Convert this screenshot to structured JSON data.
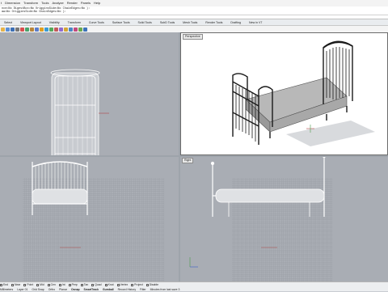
{
  "menubar": [
    "t",
    "Dimension",
    "Transform",
    "Tools",
    "Analyze",
    "Render",
    "Panels",
    "Help"
  ],
  "command_history": [
    "nce=No  DigestBox=No  OrigginsSide=No  ChainEdges=No  ):",
    "aw=No  OrigginsSide=No  ChainEdges=No  ):"
  ],
  "command_prompt": "",
  "tabs": [
    {
      "label": "Select",
      "active": false
    },
    {
      "label": "Viewport Layout",
      "active": false
    },
    {
      "label": "Visibility",
      "active": false
    },
    {
      "label": "Transform",
      "active": false
    },
    {
      "label": "Curve Tools",
      "active": false
    },
    {
      "label": "Surface Tools",
      "active": false
    },
    {
      "label": "Solid Tools",
      "active": false
    },
    {
      "label": "SubD Tools",
      "active": false
    },
    {
      "label": "Mesh Tools",
      "active": false
    },
    {
      "label": "Render Tools",
      "active": false
    },
    {
      "label": "Drafting",
      "active": false
    },
    {
      "label": "New in V7",
      "active": false
    }
  ],
  "toolbar_icons": [
    {
      "name": "new-icon",
      "color": "#e6b34a"
    },
    {
      "name": "open-icon",
      "color": "#5a8fd8"
    },
    {
      "name": "save-icon",
      "color": "#3c6fb5"
    },
    {
      "name": "print-icon",
      "color": "#777777"
    },
    {
      "name": "cut-icon",
      "color": "#d94f4f"
    },
    {
      "name": "copy-icon",
      "color": "#4aa36b"
    },
    {
      "name": "paste-icon",
      "color": "#b9853a"
    },
    {
      "name": "undo-icon",
      "color": "#5b7ec9"
    },
    {
      "name": "pan-icon",
      "color": "#e0a020"
    },
    {
      "name": "rotate-icon",
      "color": "#3a9bd5"
    },
    {
      "name": "zoom-icon",
      "color": "#56a85a"
    },
    {
      "name": "zoom-extents-icon",
      "color": "#c25b5b"
    },
    {
      "name": "zoom-window-icon",
      "color": "#8f6ad1"
    },
    {
      "name": "layer-icon",
      "color": "#d3a536"
    },
    {
      "name": "properties-icon",
      "color": "#4a86c5"
    },
    {
      "name": "render-icon",
      "color": "#c24a7e"
    },
    {
      "name": "options-icon",
      "color": "#6aa84f"
    },
    {
      "name": "help-icon",
      "color": "#3b73b9"
    }
  ],
  "viewports": {
    "top": {
      "label": ""
    },
    "perspective": {
      "label": "Perspective"
    },
    "front": {
      "label": ""
    },
    "right": {
      "label": "Right"
    }
  },
  "osnaps": [
    {
      "label": "End",
      "checked": false
    },
    {
      "label": "Near",
      "checked": false
    },
    {
      "label": "Point",
      "checked": false
    },
    {
      "label": "Mid",
      "checked": false
    },
    {
      "label": "Cen",
      "checked": false
    },
    {
      "label": "Int",
      "checked": false
    },
    {
      "label": "Perp",
      "checked": false
    },
    {
      "label": "Tan",
      "checked": false
    },
    {
      "label": "Quad",
      "checked": false
    },
    {
      "label": "Knot",
      "checked": false
    },
    {
      "label": "Vertex",
      "checked": false
    },
    {
      "label": "Project",
      "checked": false
    },
    {
      "label": "Disable",
      "checked": false
    }
  ],
  "status": {
    "unit": "Millimeters",
    "layer": "Layer 01",
    "grid_snap": "Grid Snap",
    "ortho": "Ortho",
    "planar": "Planar",
    "osnap": "Osnap",
    "smarttrack": "SmartTrack",
    "gumball": "Gumball",
    "record_history": "Record History",
    "filter": "Filter",
    "message": "Minutes from last save 3"
  },
  "colors": {
    "viewport_bg": "#a9adb4",
    "perspective_bg": "#ffffff",
    "grid_minor": "#9aa0a7",
    "grid_major": "#8b9097",
    "axis_x": "#b14848",
    "axis_y": "#4a9a4a",
    "model_wire": "#ffffff",
    "frame_black": "#1a1a1a",
    "mattress_gray": "#b5b5b5"
  }
}
